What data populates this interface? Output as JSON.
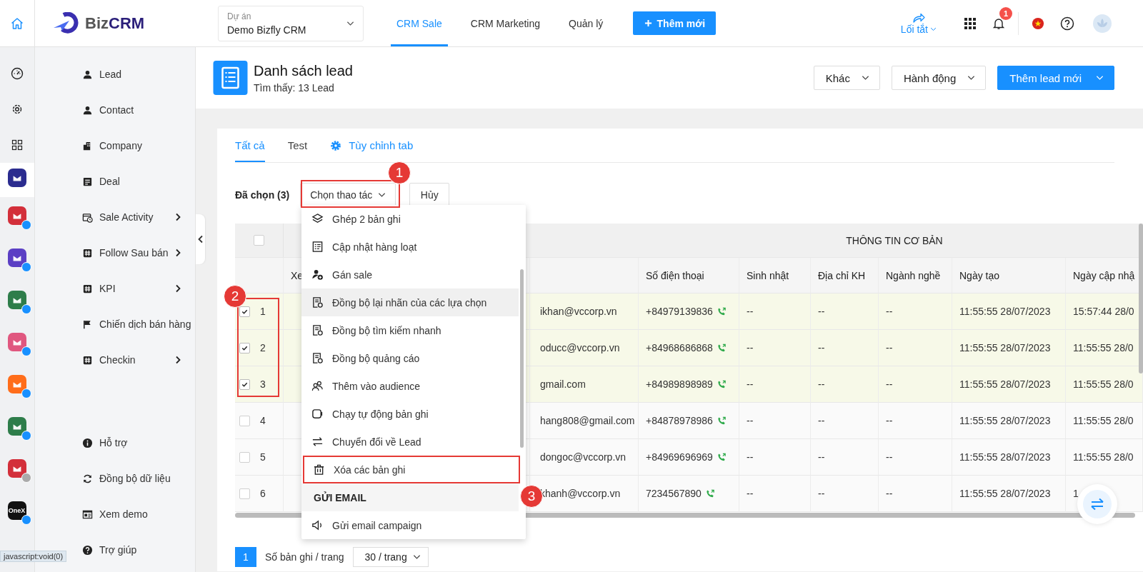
{
  "topbar": {
    "logo": {
      "part_1": "Biz",
      "part_2": "CRM"
    },
    "project": {
      "label": "Dự án",
      "value": "Demo Bizfly CRM"
    },
    "nav": [
      {
        "label": "CRM Sale",
        "selected": true
      },
      {
        "label": "CRM Marketing",
        "selected": false
      },
      {
        "label": "Quản lý",
        "selected": false
      }
    ],
    "add_button": "Thêm mới",
    "shortcut": "Lối tắt",
    "notification_count": "1"
  },
  "rail": [
    {
      "kind": "gauge",
      "selected": false
    },
    {
      "kind": "gear",
      "selected": false
    },
    {
      "kind": "grid",
      "selected": false
    },
    {
      "kind": "app",
      "color": "#2b2c8f",
      "selected": true
    },
    {
      "kind": "app",
      "color": "#d32f3a",
      "selected": false,
      "plus_enabled": true
    },
    {
      "kind": "app",
      "color": "#5b3fc4",
      "selected": false,
      "plus_enabled": true
    },
    {
      "kind": "app",
      "color": "#2e7d4a",
      "selected": false,
      "plus_enabled": true
    },
    {
      "kind": "app",
      "color": "#e0577f",
      "selected": false,
      "plus_enabled": true
    },
    {
      "kind": "app",
      "color": "#ff6d1a",
      "selected": false,
      "plus_enabled": true
    },
    {
      "kind": "app",
      "color": "#2e7d4a",
      "selected": false,
      "plus_enabled": true
    },
    {
      "kind": "app",
      "color": "#d32f3a",
      "selected": false,
      "plus_enabled": false
    },
    {
      "kind": "app",
      "color": "#111111",
      "selected": false,
      "plus_enabled": true,
      "label": "OneX"
    }
  ],
  "sidebar": {
    "items": [
      {
        "label": "Lead",
        "has_submenu": false
      },
      {
        "label": "Contact",
        "has_submenu": false
      },
      {
        "label": "Company",
        "has_submenu": false
      },
      {
        "label": "Deal",
        "has_submenu": false
      },
      {
        "label": "Sale Activity",
        "has_submenu": true
      },
      {
        "label": "Follow Sau bán",
        "has_submenu": true
      },
      {
        "label": "KPI",
        "has_submenu": true
      },
      {
        "label": "Chiến dịch bán hàng",
        "has_submenu": false
      },
      {
        "label": "Checkin",
        "has_submenu": true
      }
    ],
    "bottom_items": [
      {
        "label": "Hỗ trợ"
      },
      {
        "label": "Đồng bộ dữ liệu"
      },
      {
        "label": "Xem demo"
      },
      {
        "label": "Trợ giúp"
      }
    ]
  },
  "page_header": {
    "title": "Danh sách lead",
    "subtitle": "Tìm thấy: 13 Lead",
    "buttons": [
      {
        "label": "Khác",
        "kind": "default"
      },
      {
        "label": "Hành động",
        "kind": "default"
      },
      {
        "label": "Thêm lead mới",
        "kind": "primary"
      }
    ]
  },
  "tabs": [
    {
      "label": "Tất cả",
      "selected": true
    },
    {
      "label": "Test",
      "selected": false
    }
  ],
  "customize_tab": "Tùy chỉnh tab",
  "selection": {
    "count_label": "Đã chọn (3)",
    "action_select": "Chọn thao tác",
    "cancel": "Hủy"
  },
  "action_menu": [
    {
      "kind": "action",
      "label": "Ghép 2 bản ghi",
      "highlighted": false
    },
    {
      "kind": "action",
      "label": "Cập nhật hàng loạt",
      "highlighted": false
    },
    {
      "kind": "action",
      "label": "Gán sale",
      "highlighted": false
    },
    {
      "kind": "action",
      "label": "Đồng bộ lại nhãn của các lựa chọn",
      "highlighted": true
    },
    {
      "kind": "action",
      "label": "Đồng bộ tìm kiếm nhanh",
      "highlighted": false
    },
    {
      "kind": "action",
      "label": "Đồng bộ quảng cáo",
      "highlighted": false
    },
    {
      "kind": "action",
      "label": "Thêm vào audience",
      "highlighted": false
    },
    {
      "kind": "action",
      "label": "Chạy tự động bản ghi",
      "highlighted": false
    },
    {
      "kind": "action",
      "label": "Chuyển đổi về Lead",
      "highlighted": false
    },
    {
      "kind": "action",
      "label": "Xóa các bản ghi",
      "highlighted": false
    },
    {
      "kind": "header",
      "label": "GỬI EMAIL"
    },
    {
      "kind": "action",
      "label": "Gửi email campaign",
      "highlighted": false
    }
  ],
  "table": {
    "group_header": "THÔNG TIN CƠ BẢN",
    "header_checked": false,
    "columns": {
      "column_2": "Xe",
      "phone": "Số điện thoại",
      "birthday": "Sinh nhật",
      "address": "Địa chỉ KH",
      "industry": "Ngành nghề",
      "created": "Ngày tạo",
      "updated": "Ngày cập nhậ"
    },
    "rows": [
      {
        "number": "1",
        "selected": true,
        "column_3": "ikhan@vccorp.vn",
        "phone": "+84979139836",
        "birthday": "--",
        "address": "--",
        "industry": "--",
        "created": "11:55:55 28/07/2023",
        "updated": "15:57:44 28/0"
      },
      {
        "number": "2",
        "selected": true,
        "column_3": "oducc@vccorp.vn",
        "phone": "+84968686868",
        "birthday": "--",
        "address": "--",
        "industry": "--",
        "created": "11:55:55 28/07/2023",
        "updated": "11:55:55 28/0"
      },
      {
        "number": "3",
        "selected": true,
        "column_3": "gmail.com",
        "phone": "+84989898989",
        "birthday": "--",
        "address": "--",
        "industry": "--",
        "created": "11:55:55 28/07/2023",
        "updated": "11:55:55 28/0"
      },
      {
        "number": "4",
        "selected": false,
        "column_3": "hang808@gmail.com",
        "phone": "+84878978986",
        "birthday": "--",
        "address": "--",
        "industry": "--",
        "created": "11:55:55 28/07/2023",
        "updated": "11:55:55 28/0"
      },
      {
        "number": "5",
        "selected": false,
        "column_3": "dongoc@vccorp.vn",
        "phone": "+84969696969",
        "birthday": "--",
        "address": "--",
        "industry": "--",
        "created": "11:55:55 28/07/2023",
        "updated": "11:55:55 28/0"
      },
      {
        "number": "6",
        "selected": false,
        "column_3": "khanh@vccorp.vn",
        "phone": "7234567890",
        "birthday": "--",
        "address": "--",
        "industry": "--",
        "created": "11:55:55 28/07/2023",
        "updated": "1"
      }
    ]
  },
  "pagination": {
    "page": "1",
    "page_size_label": "Số bản ghi / trang",
    "page_size": "30 / trang"
  },
  "annotations": [
    {
      "number": "1"
    },
    {
      "number": "2"
    },
    {
      "number": "3"
    }
  ],
  "status_bar": "javascript:void(0)"
}
